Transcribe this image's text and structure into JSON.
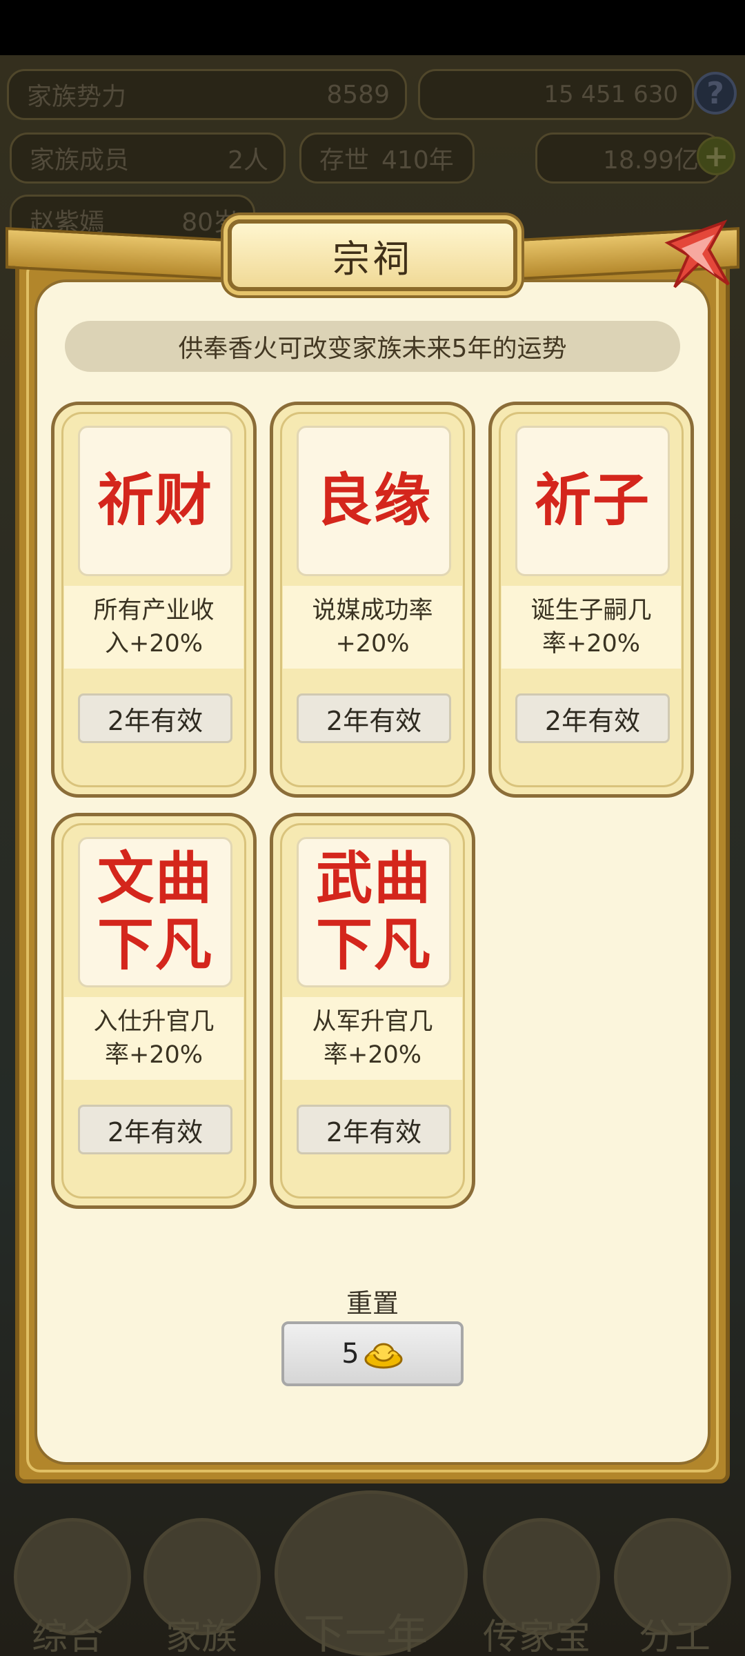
{
  "background_hud": {
    "family_power_label": "家族势力",
    "family_power_value": "8589",
    "resources_label": "15 451 630",
    "family_members_label": "家族成员",
    "family_members_value": "2人",
    "alive_years_label": "存世",
    "alive_years_value": "410年",
    "gold_amount": "18.99亿",
    "player_name": "赵紫嫣",
    "player_age": "80岁"
  },
  "bottom_nav": {
    "items": [
      {
        "label": "综合"
      },
      {
        "label": "家族"
      },
      {
        "label": "下一年"
      },
      {
        "label": "传家宝"
      },
      {
        "label": "分工"
      }
    ]
  },
  "modal": {
    "title": "宗祠",
    "subtitle": "供奉香火可改变家族未来5年的运势",
    "cards": [
      {
        "name": "祈财",
        "desc": "所有产业收入+20%",
        "button": "2年有效"
      },
      {
        "name": "良缘",
        "desc": "说媒成功率+20%",
        "button": "2年有效"
      },
      {
        "name": "祈子",
        "desc": "诞生子嗣几率+20%",
        "button": "2年有效"
      },
      {
        "name": "文曲下凡",
        "desc": "入仕升官几率+20%",
        "button": "2年有效"
      },
      {
        "name": "武曲下凡",
        "desc": "从军升官几率+20%",
        "button": "2年有效"
      }
    ],
    "reset_label": "重置",
    "reset_cost": "5",
    "icons": {
      "close": "close-ribbon-icon",
      "reset_currency": "gold-ingot-icon"
    }
  },
  "colors": {
    "card_title_red": "#d4261c",
    "frame_gold": "#b2862b",
    "panel_cream": "#fbf5dc"
  }
}
